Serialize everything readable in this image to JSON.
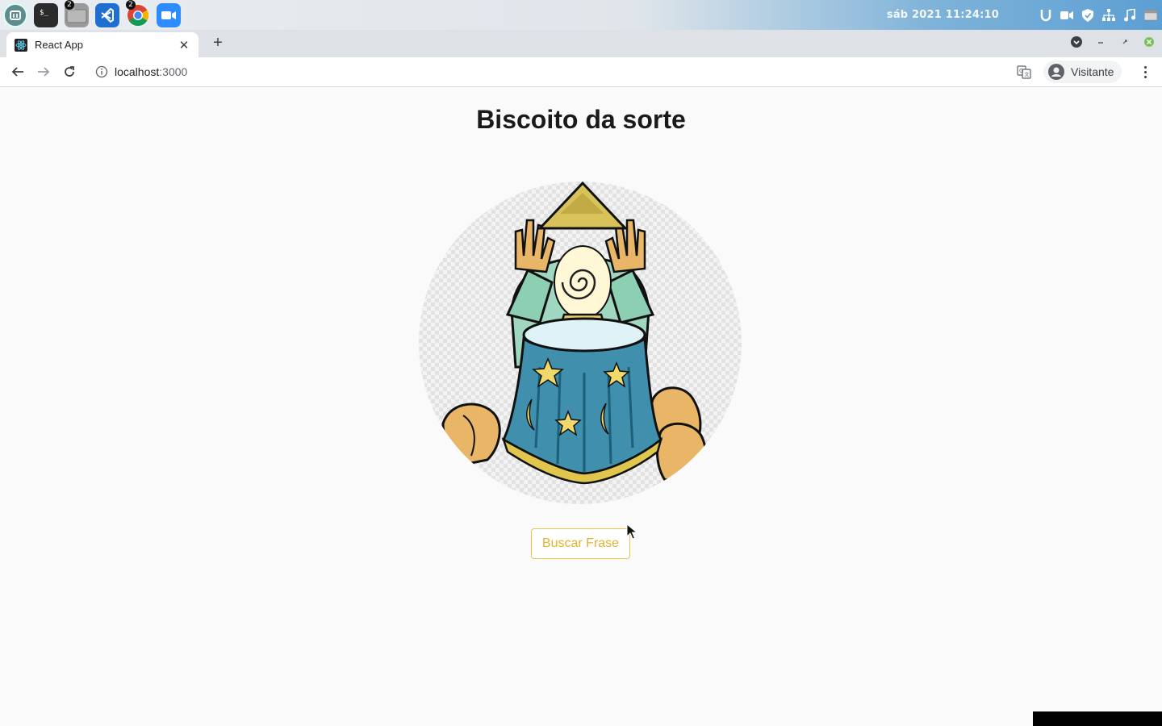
{
  "os": {
    "launcher": [
      {
        "name": "mint-menu",
        "badge": ""
      },
      {
        "name": "terminal",
        "badge": ""
      },
      {
        "name": "files",
        "badge": "2"
      },
      {
        "name": "vscode",
        "badge": ""
      },
      {
        "name": "chrome",
        "badge": "2"
      },
      {
        "name": "zoom",
        "badge": ""
      }
    ],
    "datetime": "sáb  2021  11:24:10",
    "tray_icons": [
      "ublock-icon",
      "video-icon",
      "shield-icon",
      "network-icon",
      "music-icon",
      "window-icon"
    ]
  },
  "browser": {
    "tab": {
      "title": "React App"
    },
    "new_tab_label": "+",
    "url_host": "localhost",
    "url_port": ":3000",
    "profile_name": "Visitante"
  },
  "page": {
    "title": "Biscoito da sorte",
    "button_label": "Buscar Frase",
    "accent": "#e0b42c"
  }
}
